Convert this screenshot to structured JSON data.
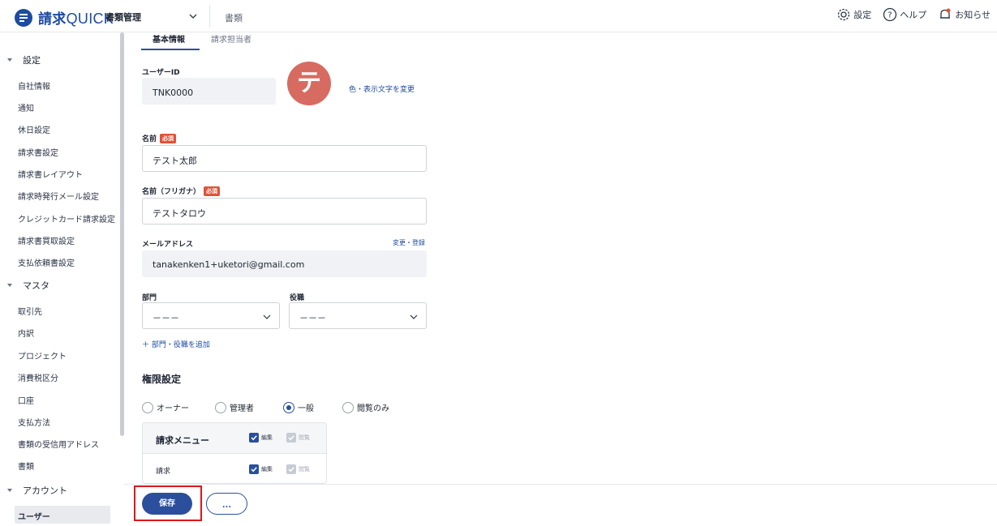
{
  "header": {
    "logo_text": "請求",
    "logo_suffix": "QUICK",
    "module": "書類管理",
    "sub_module": "書類",
    "actions": [
      {
        "label": "設定",
        "icon": "gear-icon"
      },
      {
        "label": "ヘルプ",
        "icon": "help-icon"
      },
      {
        "label": "お知らせ",
        "icon": "bell-icon"
      }
    ]
  },
  "sidebar": {
    "groups": [
      {
        "label": "設定",
        "items": [
          "自社情報",
          "通知",
          "休日設定",
          "請求書設定",
          "請求書レイアウト",
          "請求時発行メール設定",
          "クレジットカード請求設定",
          "請求書買取設定",
          "支払依頼書設定"
        ]
      },
      {
        "label": "マスタ",
        "items": [
          "取引先",
          "内訳",
          "プロジェクト",
          "消費税区分",
          "口座",
          "支払方法",
          "書類の受信用アドレス",
          "書類"
        ]
      },
      {
        "label": "アカウント",
        "items": [
          "ユーザー"
        ]
      }
    ],
    "active_item": "ユーザー"
  },
  "tabs": [
    {
      "label": "基本情報",
      "active": true
    },
    {
      "label": "請求担当者",
      "active": false
    }
  ],
  "form": {
    "user_id": {
      "label": "ユーザーID",
      "value": "TNK0000"
    },
    "avatar": {
      "initial": "テ",
      "color": "#d86b61",
      "change_link": "色・表示文字を変更"
    },
    "name": {
      "label": "名前",
      "required_badge": "必須",
      "value": "テスト太郎"
    },
    "name_kana": {
      "label": "名前（フリガナ）",
      "required_badge": "必須",
      "value": "テストタロウ"
    },
    "email": {
      "label": "メールアドレス",
      "link": "変更・登録",
      "value": "tanakenken1+uketori@gmail.com"
    },
    "department": {
      "label": "部門",
      "value": "－－－"
    },
    "position": {
      "label": "役職",
      "value": "－－－"
    },
    "add_link": "＋ 部門・役職を追加"
  },
  "permissions": {
    "title": "権限設定",
    "roles": [
      {
        "label": "オーナー",
        "selected": false
      },
      {
        "label": "管理者",
        "selected": false
      },
      {
        "label": "一般",
        "selected": true
      },
      {
        "label": "閲覧のみ",
        "selected": false
      }
    ],
    "table": {
      "header": "請求メニュー",
      "edit_label": "編集",
      "view_label": "閲覧",
      "rows": [
        {
          "label": "請求",
          "edit": true,
          "view": true
        }
      ]
    }
  },
  "footer": {
    "save_label": "保存",
    "more_label": "…"
  },
  "colors": {
    "primary": "#2b4f9c",
    "required": "#e0523a",
    "highlight": "#e0151b"
  }
}
